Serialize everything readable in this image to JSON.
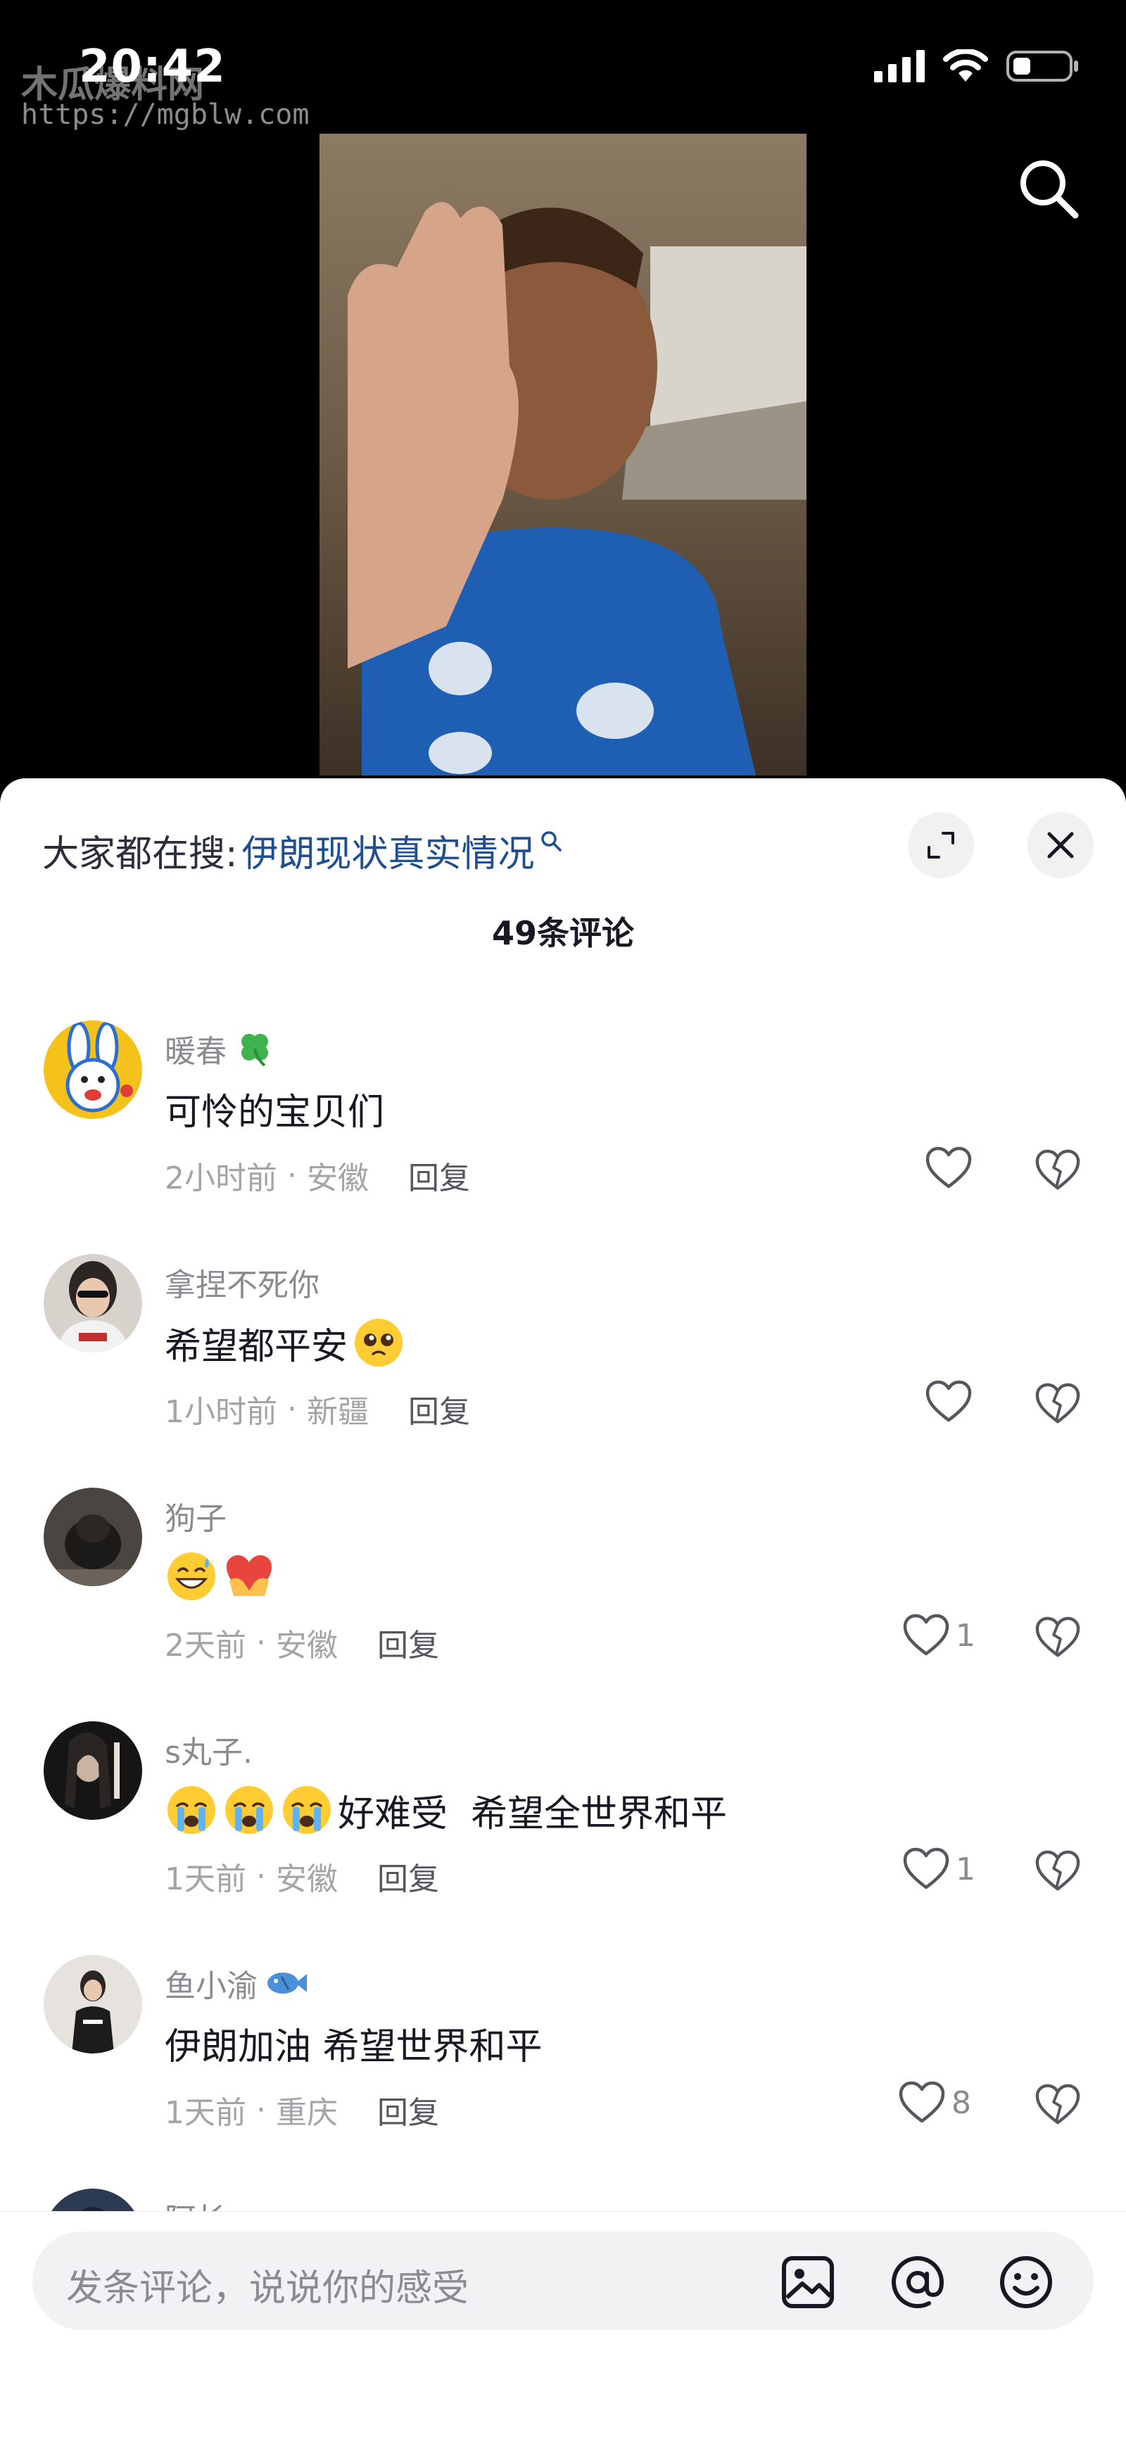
{
  "status": {
    "time": "20:42"
  },
  "watermark": {
    "name": "木瓜爆料网",
    "url": "https://mgblw.com"
  },
  "search_suggest": {
    "prefix": "大家都在搜:",
    "term": "伊朗现状真实情况"
  },
  "comments_header": {
    "count_label": "49条评论"
  },
  "comments": [
    {
      "name": "暖春",
      "text": "可怜的宝贝们",
      "time": "2小时前",
      "location": "安徽",
      "reply": "回复",
      "likes": ""
    },
    {
      "name": "拿捏不死你",
      "text": "希望都平安",
      "time": "1小时前",
      "location": "新疆",
      "reply": "回复",
      "likes": ""
    },
    {
      "name": "狗子",
      "text": "",
      "time": "2天前",
      "location": "安徽",
      "reply": "回复",
      "likes": "1"
    },
    {
      "name": "s丸子.",
      "text": "好难受  希望全世界和平",
      "time": "1天前",
      "location": "安徽",
      "reply": "回复",
      "likes": "1"
    },
    {
      "name": "鱼小渝",
      "text": "伊朗加油 希望世界和平",
      "time": "1天前",
      "location": "重庆",
      "reply": "回复",
      "likes": "8"
    },
    {
      "name": "阿长",
      "text": ""
    }
  ],
  "input": {
    "placeholder": "发条评论，说说你的感受"
  },
  "colors": {
    "link_blue": "#1f4e91",
    "sheet_bg": "#ffffff",
    "muted_text": "#8a8b91"
  },
  "icons": [
    "search-icon",
    "expand-icon",
    "close-icon",
    "heart-icon",
    "broken-heart-icon",
    "image-icon",
    "at-icon",
    "emoji-icon"
  ]
}
